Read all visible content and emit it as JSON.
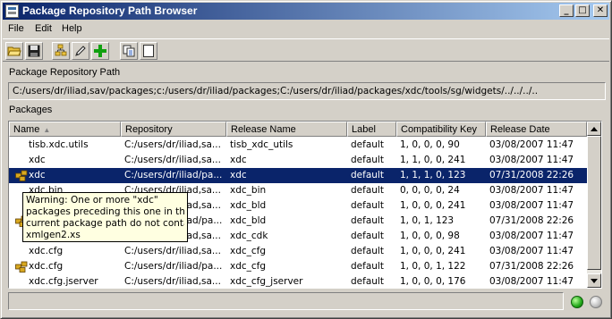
{
  "window": {
    "title": "Package Repository Path Browser"
  },
  "title_buttons": {
    "minimize": "_",
    "maximize": "□",
    "close": "✕"
  },
  "menu": [
    "File",
    "Edit",
    "Help"
  ],
  "toolbar": [
    {
      "icon": "open-folder-icon"
    },
    {
      "icon": "save-disk-icon"
    },
    {
      "icon": "package-tree-icon"
    },
    {
      "icon": "pencil-edit-icon"
    },
    {
      "icon": "add-plus-icon"
    },
    {
      "icon": "copy-icon"
    },
    {
      "icon": "blank-page-icon"
    }
  ],
  "path_section": {
    "label": "Package Repository Path",
    "value": "C:/users/dr/iliad,sav/packages;c:/users/dr/iliad/packages;C:/users/dr/iliad/packages/xdc/tools/sg/widgets/../../../.."
  },
  "packages_section": {
    "label": "Packages"
  },
  "table": {
    "columns": [
      "Name",
      "Repository",
      "Release Name",
      "Label",
      "Compatibility Key",
      "Release Date"
    ],
    "sorted_column_indicator": "▲",
    "rows": [
      {
        "icon": "",
        "name": "tisb.xdc.utils",
        "repository": "C:/users/dr/iliad,sa...",
        "release_name": "tisb_xdc_utils",
        "label": "default",
        "compat_key": "1, 0, 0, 0, 90",
        "release_date": "03/08/2007  11:47",
        "selected": false
      },
      {
        "icon": "",
        "name": "xdc",
        "repository": "C:/users/dr/iliad,sa...",
        "release_name": "xdc",
        "label": "default",
        "compat_key": "1, 1, 0, 0, 241",
        "release_date": "03/08/2007  11:47",
        "selected": false
      },
      {
        "icon": "warning-package-icon",
        "name": "xdc",
        "repository": "C:/users/dr/iliad/pa...",
        "release_name": "xdc",
        "label": "default",
        "compat_key": "1, 1, 1, 0, 123",
        "release_date": "07/31/2008  22:26",
        "selected": true
      },
      {
        "icon": "",
        "name": "xdc.bin",
        "repository": "C:/users/dr/iliad,sa...",
        "release_name": "xdc_bin",
        "label": "default",
        "compat_key": "0, 0, 0, 0, 24",
        "release_date": "03/08/2007  11:47",
        "selected": false
      },
      {
        "icon": "",
        "name": "",
        "repository": "C:/users/dr/iliad,sa...",
        "release_name": "xdc_bld",
        "label": "default",
        "compat_key": "1, 0, 0, 0, 241",
        "release_date": "03/08/2007  11:47",
        "selected": false
      },
      {
        "icon": "warning-package-icon",
        "name": "",
        "repository": "C:/users/dr/iliad/pa...",
        "release_name": "xdc_bld",
        "label": "default",
        "compat_key": "1, 0, 1, 123",
        "release_date": "07/31/2008  22:26",
        "selected": false
      },
      {
        "icon": "",
        "name": "",
        "repository": "C:/users/dr/iliad,sa...",
        "release_name": "xdc_cdk",
        "label": "default",
        "compat_key": "1, 0, 0, 0, 98",
        "release_date": "03/08/2007  11:47",
        "selected": false
      },
      {
        "icon": "",
        "name": "xdc.cfg",
        "repository": "C:/users/dr/iliad,sa...",
        "release_name": "xdc_cfg",
        "label": "default",
        "compat_key": "1, 0, 0, 0, 241",
        "release_date": "03/08/2007  11:47",
        "selected": false
      },
      {
        "icon": "warning-package-icon",
        "name": "xdc.cfg",
        "repository": "C:/users/dr/iliad/pa...",
        "release_name": "xdc_cfg",
        "label": "default",
        "compat_key": "1, 0, 0, 1, 122",
        "release_date": "07/31/2008  22:26",
        "selected": false
      },
      {
        "icon": "",
        "name": "xdc.cfg.jserver",
        "repository": "C:/users/dr/iliad,sa...",
        "release_name": "xdc_cfg_jserver",
        "label": "default",
        "compat_key": "1, 0, 0, 0, 176",
        "release_date": "03/08/2007  11:47",
        "selected": false
      }
    ]
  },
  "tooltip": {
    "lines": [
      "Warning: One or more \"xdc\"",
      "packages preceding this one in the",
      "current package path do not contain:",
      "xmlgen2.xs"
    ]
  },
  "status": {
    "text": "",
    "indicators": [
      "green-led-icon",
      "gray-led-icon"
    ]
  },
  "colors": {
    "title_gradient_start": "#0a246a",
    "selection": "#0a246a",
    "tooltip_bg": "#ffffe1",
    "face": "#d4d0c8"
  }
}
